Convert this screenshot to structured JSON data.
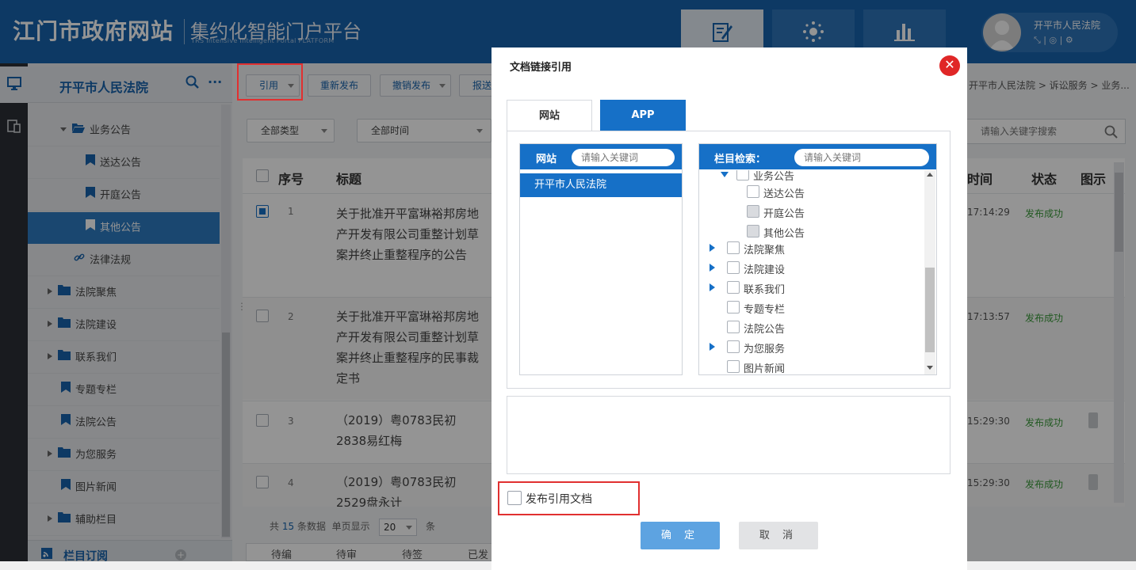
{
  "header": {
    "logo": "江门市政府网站",
    "subtitle": "集约化智能门户平台",
    "subtitle_en": "TRS Intensive Intelligent Portal PLATFORM",
    "nav": [
      "edit-icon",
      "hub-icon",
      "chart-icon"
    ],
    "user": "开平市人民法院"
  },
  "sidebar": {
    "title": "开平市人民法院",
    "items": [
      {
        "label": "业务公告",
        "icon": "folder-open-icon",
        "expanded": true
      },
      {
        "label": "送达公告",
        "icon": "bookmark-icon"
      },
      {
        "label": "开庭公告",
        "icon": "bookmark-icon"
      },
      {
        "label": "其他公告",
        "icon": "bookmark-icon",
        "active": true
      },
      {
        "label": "法律法规",
        "icon": "link-icon"
      },
      {
        "label": "法院聚焦",
        "icon": "folder-icon"
      },
      {
        "label": "法院建设",
        "icon": "folder-icon"
      },
      {
        "label": "联系我们",
        "icon": "folder-icon"
      },
      {
        "label": "专题专栏",
        "icon": "bookmark-icon"
      },
      {
        "label": "法院公告",
        "icon": "bookmark-icon"
      },
      {
        "label": "为您服务",
        "icon": "folder-icon"
      },
      {
        "label": "图片新闻",
        "icon": "bookmark-icon"
      },
      {
        "label": "辅助栏目",
        "icon": "folder-icon"
      }
    ],
    "subscribe": "栏目订阅"
  },
  "toolbar": {
    "cite": "引用",
    "republish": "重新发布",
    "unpublish": "撤销发布",
    "report": "报送"
  },
  "breadcrumb": "开平市人民法院 > 诉讼服务 > 业务...",
  "filters": {
    "type": "全部类型",
    "time": "全部时间",
    "search_placeholder": "请输入关键字搜索"
  },
  "table": {
    "columns": {
      "seq": "序号",
      "title": "标题",
      "time": "时间",
      "status": "状态",
      "preview": "图示"
    },
    "rows": [
      {
        "seq": "1",
        "title": "关于批准开平富琳裕邦房地产开发有限公司重整计划草案并终止重整程序的公告",
        "time": "17:14:29",
        "status": "发布成功",
        "checked": true
      },
      {
        "seq": "2",
        "title": "关于批准开平富琳裕邦房地产开发有限公司重整计划草案并终止重整程序的民事裁定书",
        "time": "17:13:57",
        "status": "发布成功"
      },
      {
        "seq": "3",
        "title": "（2019）粤0783民初2838易红梅",
        "time": "15:29:30",
        "status": "发布成功"
      },
      {
        "seq": "4",
        "title": "（2019）粤0783民初2529盘永计",
        "time": "15:29:30",
        "status": "发布成功"
      }
    ]
  },
  "pager": {
    "total_prefix": "共",
    "total": "15",
    "total_suffix": "条数据",
    "per_page_label": "单页显示",
    "per_page": "20",
    "unit": "条"
  },
  "workflow": [
    "待编",
    "待审",
    "待签",
    "已发"
  ],
  "dialog": {
    "title": "文档链接引用",
    "tab_web": "网站",
    "tab_app": "APP",
    "site_label": "网站",
    "site_placeholder": "请输入关键词",
    "sites": [
      "开平市人民法院"
    ],
    "column_label": "栏目检索：",
    "column_placeholder": "请输入关键词",
    "columns": [
      "业务公告",
      "送达公告",
      "开庭公告",
      "其他公告",
      "法院聚焦",
      "法院建设",
      "联系我们",
      "专题专栏",
      "法院公告",
      "为您服务",
      "图片新闻"
    ],
    "publish_cited": "发布引用文档",
    "ok": "确  定",
    "cancel": "取  消"
  }
}
